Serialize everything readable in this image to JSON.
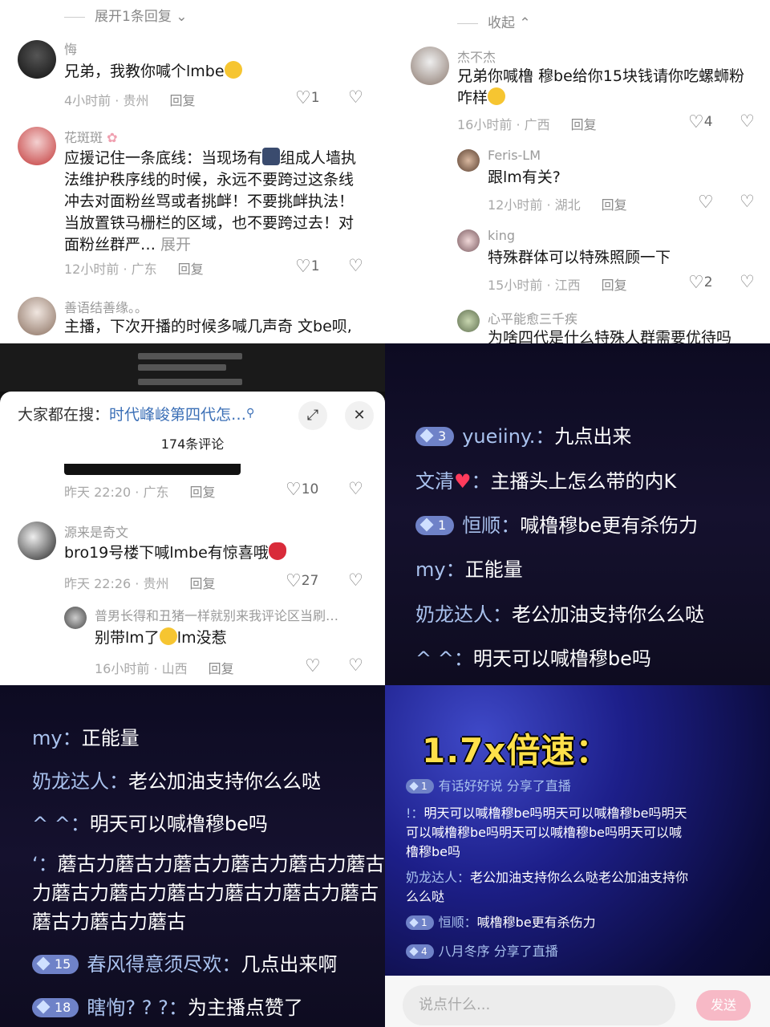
{
  "top_left": {
    "expand_label": "展开1条回复",
    "comments": [
      {
        "user": "悔",
        "text": "兄弟，我教你喊个lmbe",
        "time": "4小时前",
        "region": "贵州",
        "reply": "回复",
        "likes": "1"
      },
      {
        "user": "花斑斑",
        "text_a": "应援记住一条底线：当现场有",
        "text_b": "组成人墙执法维护秩序线的时候，永远不要跨过这条线冲去对面粉丝骂或者挑衅！不要挑衅执法！当放置铁马栅栏的区域，也不要跨过去！对面粉丝群严…",
        "more": "展开",
        "time": "12小时前",
        "region": "广东",
        "reply": "回复",
        "likes": "1"
      },
      {
        "user": "善语结善缘。。",
        "text": "主播，下次开播的时候多喊几声奇 文be呗,"
      }
    ]
  },
  "top_right": {
    "collapse_label": "收起",
    "comments": [
      {
        "user": "杰不杰",
        "text": "兄弟你喊橹 穆be给你15块钱请你吃螺蛳粉咋样",
        "time": "16小时前",
        "region": "广西",
        "reply": "回复",
        "likes": "4"
      },
      {
        "user": "Feris-LM",
        "text": "跟lm有关?",
        "time": "12小时前",
        "region": "湖北",
        "reply": "回复",
        "likes": ""
      },
      {
        "user": "king",
        "text": "特殊群体可以特殊照顾一下",
        "time": "15小时前",
        "region": "江西",
        "reply": "回复",
        "likes": "2"
      },
      {
        "user": "心平能愈三千疾",
        "text": "为啥四代是什么特殊人群需要优待吗"
      }
    ]
  },
  "search_panel": {
    "search_prefix": "大家都在搜：",
    "search_term": "时代峰峻第四代怎…",
    "comment_count": "174条评论",
    "comments": [
      {
        "time": "昨天 22:20",
        "region": "广东",
        "reply": "回复",
        "likes": "10"
      },
      {
        "user": "源来是奇文",
        "text": "bro19号楼下喊lmbe有惊喜哦",
        "time": "昨天 22:26",
        "region": "贵州",
        "reply": "回复",
        "likes": "27"
      },
      {
        "user": "普男长得和丑猪一样就别来我评论区当刷…",
        "text_a": "别带lm了",
        "text_b": "lm没惹",
        "time": "16小时前",
        "region": "山西",
        "reply": "回复",
        "likes": ""
      }
    ]
  },
  "live_chat_1": {
    "messages": [
      {
        "badge": "3",
        "name": "yueiiny.",
        "text": "九点出来"
      },
      {
        "badge": "",
        "name": "文清",
        "text": "主播头上怎么带的内K"
      },
      {
        "badge": "1",
        "name": "恒顺",
        "text": "喊橹穆be更有杀伤力"
      },
      {
        "badge": "",
        "name": "my",
        "text": "正能量"
      },
      {
        "badge": "",
        "name": "奶龙达人",
        "text": "老公加油支持你么么哒"
      },
      {
        "badge": "",
        "name": "^ ^",
        "text": "明天可以喊橹穆be吗"
      }
    ]
  },
  "live_chat_2": {
    "messages": [
      {
        "badge": "",
        "name": "my",
        "text": "正能量"
      },
      {
        "badge": "",
        "name": "奶龙达人",
        "text": "老公加油支持你么么哒"
      },
      {
        "badge": "",
        "name": "^ ^",
        "text": "明天可以喊橹穆be吗"
      },
      {
        "badge": "",
        "name": "‘",
        "text_l1": "蘑古力蘑古力蘑古力蘑古力蘑古力蘑古",
        "text_l2": "力蘑古力蘑古力蘑古力蘑古力蘑古力蘑古",
        "text_l3": "蘑古力蘑古力蘑古"
      },
      {
        "badge": "15",
        "name": "春风得意须尽欢",
        "text": "几点出来啊"
      },
      {
        "badge": "18",
        "name": "瞎恂? ? ?",
        "text": "为主播点赞了"
      }
    ]
  },
  "speed_panel": {
    "title": "1.7x倍速：",
    "messages": [
      {
        "badge": "1",
        "name": "有话好好说",
        "text": "分享了直播"
      },
      {
        "name": "!",
        "text": "明天可以喊橹穆be吗明天可以喊橹穆be吗明天可以喊橹穆be吗明天可以喊橹穆be吗明天可以喊橹穆be吗"
      },
      {
        "name": "奶龙达人",
        "text": "老公加油支持你么么哒老公加油支持你么么哒"
      },
      {
        "badge": "1",
        "name": "恒顺",
        "text": "喊橹穆be更有杀伤力"
      },
      {
        "badge": "4",
        "name": "八月冬序",
        "text": "分享了直播"
      }
    ],
    "input_placeholder": "说点什么...",
    "send_label": "发送"
  },
  "colors": {
    "badge": "#6f82c8",
    "name": "#a9c2ee",
    "speed_title": "#ffe04a"
  }
}
